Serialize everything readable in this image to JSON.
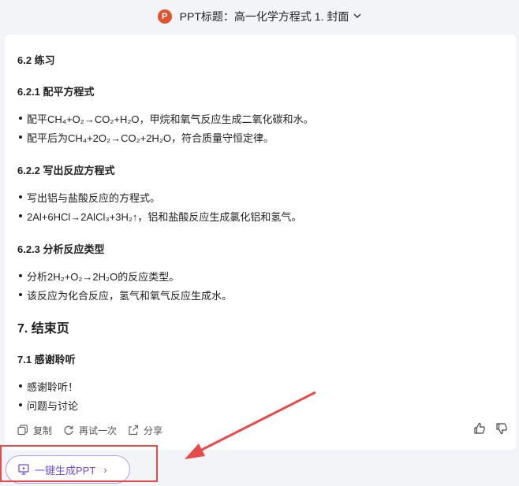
{
  "header": {
    "logo_letter": "P",
    "title": "PPT标题：高一化学方程式 1. 封面",
    "chevron": "⌄"
  },
  "content": {
    "s62": "6.2 练习",
    "s621": "6.2.1 配平方程式",
    "s621_items": [
      "配平CH₄+O₂→CO₂+H₂O，甲烷和氧气反应生成二氧化碳和水。",
      "配平后为CH₄+2O₂→CO₂+2H₂O，符合质量守恒定律。"
    ],
    "s622": "6.2.2 写出反应方程式",
    "s622_items": [
      "写出铝与盐酸反应的方程式。",
      "2Al+6HCl→2AlCl₃+3H₂↑，铝和盐酸反应生成氯化铝和氢气。"
    ],
    "s623": "6.2.3 分析反应类型",
    "s623_items": [
      "分析2H₂+O₂→2H₂O的反应类型。",
      "该反应为化合反应，氢气和氧气反应生成水。"
    ],
    "s7": "7. 结束页",
    "s71": "7.1 感谢聆听",
    "s71_items": [
      "感谢聆听！",
      "问题与讨论"
    ]
  },
  "actions": {
    "copy": "复制",
    "retry": "再试一次",
    "share": "分享",
    "icons": [
      "copy-icon",
      "refresh-icon",
      "share-icon",
      "thumbs-up-icon",
      "thumbs-down-icon"
    ]
  },
  "generate_button": {
    "label": "一键生成PPT",
    "arrow": "›"
  },
  "colors": {
    "accent": "#6b4ce6",
    "highlight": "#e84a4a",
    "ppt_logo": "#e0532f"
  }
}
